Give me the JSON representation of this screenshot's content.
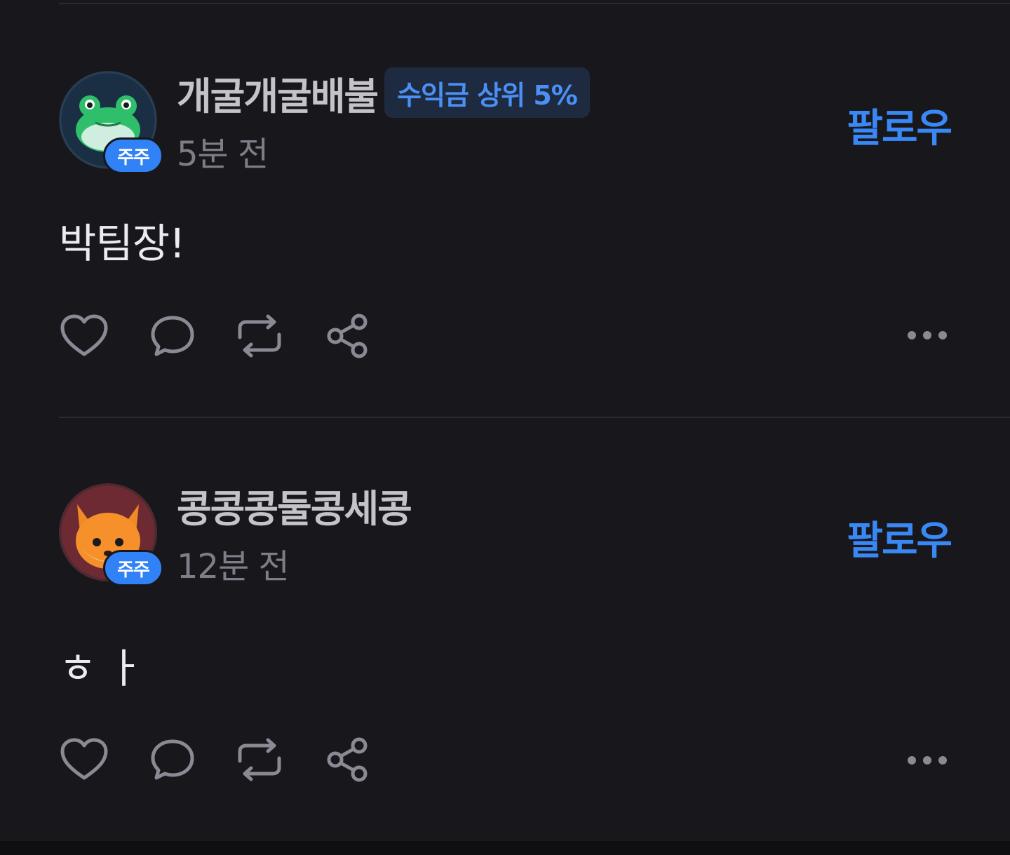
{
  "colors": {
    "background": "#17171c",
    "accent": "#3182f6",
    "follow_text": "#3a88f5",
    "badge_bg": "#1e2a40",
    "muted_text": "#7e7e88"
  },
  "posts": [
    {
      "author": "개굴개굴배불",
      "rank_badge": "수익금 상위 5%",
      "holder_badge": "주주",
      "time": "5분 전",
      "follow_label": "팔로우",
      "content": "박팀장!",
      "avatar_icon": "frog-icon"
    },
    {
      "author": "콩콩콩둘콩세콩",
      "rank_badge": "",
      "holder_badge": "주주",
      "time": "12분 전",
      "follow_label": "팔로우",
      "content": "ㅎㅏ",
      "avatar_icon": "fox-icon"
    }
  ],
  "actions": {
    "like_icon": "heart-icon",
    "comment_icon": "comment-icon",
    "repost_icon": "repost-icon",
    "share_icon": "share-icon",
    "more_icon": "more-icon"
  }
}
